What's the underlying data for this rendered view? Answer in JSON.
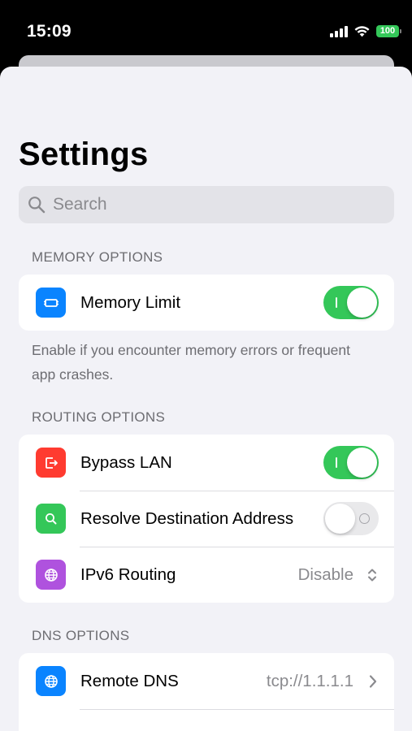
{
  "status_bar": {
    "time": "15:09",
    "battery": "100",
    "icons": [
      "cellular-signal-icon",
      "wifi-icon",
      "battery-icon"
    ]
  },
  "page": {
    "title": "Settings"
  },
  "search": {
    "placeholder": "Search"
  },
  "sections": {
    "memory": {
      "header": "MEMORY OPTIONS",
      "rows": [
        {
          "label": "Memory Limit",
          "icon": "memory-chip-icon",
          "icon_color": "#0a84ff",
          "toggle": true
        }
      ],
      "footer": "Enable if you encounter memory errors or frequent app crashes."
    },
    "routing": {
      "header": "ROUTING OPTIONS",
      "rows": [
        {
          "label": "Bypass LAN",
          "icon": "bypass-icon",
          "icon_color": "#ff3b30",
          "toggle": true
        },
        {
          "label": "Resolve Destination Address",
          "icon": "magnifier-icon",
          "icon_color": "#34c759",
          "toggle": false
        },
        {
          "label": "IPv6 Routing",
          "icon": "globe-icon",
          "icon_color": "#af52de",
          "value": "Disable"
        }
      ]
    },
    "dns": {
      "header": "DNS OPTIONS",
      "rows": [
        {
          "label": "Remote DNS",
          "icon": "globe-icon",
          "icon_color": "#0a84ff",
          "value": "tcp://1.1.1.1"
        }
      ]
    }
  },
  "colors": {
    "accent_green": "#34c759",
    "background": "#f2f2f7",
    "secondary_text": "#8a8a8e"
  }
}
